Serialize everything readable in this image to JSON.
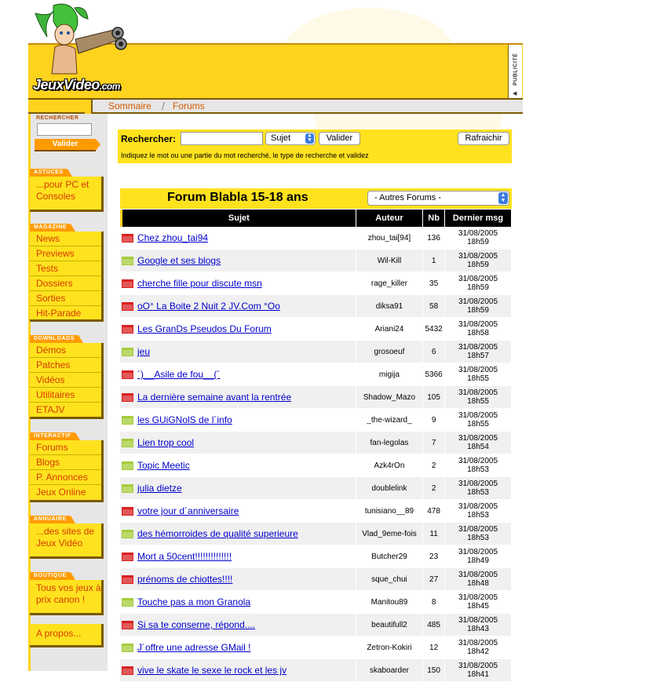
{
  "site": {
    "logo_text": "JeuxVideo",
    "logo_suffix": ".com",
    "pub_label": "PUBLICITÉ"
  },
  "breadcrumb": [
    {
      "label": "Sommaire"
    },
    {
      "label": "Forums"
    }
  ],
  "sidebar": {
    "search_label": "RECHERCHER",
    "search_button": "Valider",
    "sections": [
      {
        "tab": "ASTUCES",
        "items": [
          "...pour PC et Consoles"
        ],
        "multi": true
      },
      {
        "tab": "MAGAZINE",
        "items": [
          "News",
          "Previews",
          "Tests",
          "Dossiers",
          "Sorties",
          "Hit-Parade"
        ]
      },
      {
        "tab": "DOWNLOADS",
        "items": [
          "Démos",
          "Patches",
          "Vidéos",
          "Utilitaires",
          "ETAJV"
        ]
      },
      {
        "tab": "INTERACTIF",
        "items": [
          "Forums",
          "Blogs",
          "P. Annonces",
          "Jeux Online"
        ]
      },
      {
        "tab": "ANNUAIRE",
        "items": [
          "...des sites de Jeux Vidéo"
        ],
        "multi": true
      },
      {
        "tab": "BOUTIQUE",
        "items": [
          "Tous vos jeux à prix canon !"
        ],
        "multi": true
      },
      {
        "tab": "",
        "items": [
          "A propos..."
        ],
        "multi": true
      }
    ]
  },
  "searchbar": {
    "label": "Rechercher:",
    "select_value": "Sujet",
    "validate_button": "Valider",
    "refresh_button": "Rafraichir",
    "help": "Indiquez le mot ou une partie du mot recherché, le type de recherche et validez"
  },
  "forum": {
    "title": "Forum Blabla 15-18 ans",
    "other_forums": "- Autres Forums -",
    "columns": [
      "Sujet",
      "Auteur",
      "Nb",
      "Dernier msg"
    ],
    "rows": [
      {
        "hot": true,
        "subject": "Chez zhou_tai94",
        "author": "zhou_tai[94]",
        "nb": "136",
        "date": "31/08/2005",
        "time": "18h59"
      },
      {
        "hot": false,
        "subject": "Google et ses blogs",
        "author": "Wil-Kill",
        "nb": "1",
        "date": "31/08/2005",
        "time": "18h59"
      },
      {
        "hot": true,
        "subject": "cherche fille pour discute msn",
        "author": "rage_killer",
        "nb": "35",
        "date": "31/08/2005",
        "time": "18h59"
      },
      {
        "hot": true,
        "subject": "oO° La Boite 2 Nuit 2 JV.Com °Oo",
        "author": "diksa91",
        "nb": "58",
        "date": "31/08/2005",
        "time": "18h59"
      },
      {
        "hot": true,
        "subject": "Les GranDs Pseudos Du Forum",
        "author": "Ariani24",
        "nb": "5432",
        "date": "31/08/2005",
        "time": "18h58"
      },
      {
        "hot": false,
        "subject": "jeu",
        "author": "grosoeuf",
        "nb": "6",
        "date": "31/08/2005",
        "time": "18h57"
      },
      {
        "hot": true,
        "subject": "´)__Asile de fou__(´",
        "author": "migija",
        "nb": "5366",
        "date": "31/08/2005",
        "time": "18h55"
      },
      {
        "hot": true,
        "subject": "La dernière semaine avant la rentrée",
        "author": "Shadow_Mazo",
        "nb": "105",
        "date": "31/08/2005",
        "time": "18h55"
      },
      {
        "hot": false,
        "subject": "les GUiGNolS de l´info",
        "author": "_the-wizard_",
        "nb": "9",
        "date": "31/08/2005",
        "time": "18h55"
      },
      {
        "hot": false,
        "subject": "Lien trop cool",
        "author": "fan-legolas",
        "nb": "7",
        "date": "31/08/2005",
        "time": "18h54"
      },
      {
        "hot": false,
        "subject": "Topic Meetic",
        "author": "Azk4rOn",
        "nb": "2",
        "date": "31/08/2005",
        "time": "18h53"
      },
      {
        "hot": false,
        "subject": "julia dietze",
        "author": "doublelink",
        "nb": "2",
        "date": "31/08/2005",
        "time": "18h53"
      },
      {
        "hot": true,
        "subject": "votre jour d´anniversaire",
        "author": "tunisiano__89",
        "nb": "478",
        "date": "31/08/2005",
        "time": "18h53"
      },
      {
        "hot": false,
        "subject": "des hémorroides de qualité superieure",
        "author": "Vlad_9eme-fois",
        "nb": "11",
        "date": "31/08/2005",
        "time": "18h53"
      },
      {
        "hot": true,
        "subject": "Mort a 50cent!!!!!!!!!!!!!!",
        "author": "Butcher29",
        "nb": "23",
        "date": "31/08/2005",
        "time": "18h49"
      },
      {
        "hot": true,
        "subject": "prénoms de chiottes!!!!",
        "author": "sque_chui",
        "nb": "27",
        "date": "31/08/2005",
        "time": "18h48"
      },
      {
        "hot": false,
        "subject": "Touche pas a mon Granola",
        "author": "Manitou89",
        "nb": "8",
        "date": "31/08/2005",
        "time": "18h45"
      },
      {
        "hot": true,
        "subject": "Si sa te conserne, répond....",
        "author": "beautifull2",
        "nb": "485",
        "date": "31/08/2005",
        "time": "18h43"
      },
      {
        "hot": false,
        "subject": "J´offre une adresse GMail !",
        "author": "Zetron-Kokiri",
        "nb": "12",
        "date": "31/08/2005",
        "time": "18h42"
      },
      {
        "hot": true,
        "subject": "vive le skate le sexe le rock et les jv",
        "author": "skaboarder",
        "nb": "150",
        "date": "31/08/2005",
        "time": "18h41"
      }
    ]
  },
  "colors": {
    "yellow": "#ffd21e",
    "orange": "#ff9b00",
    "link": "#0000cc",
    "hot_folder": "#d92020",
    "normal_folder": "#a4cc3a"
  }
}
